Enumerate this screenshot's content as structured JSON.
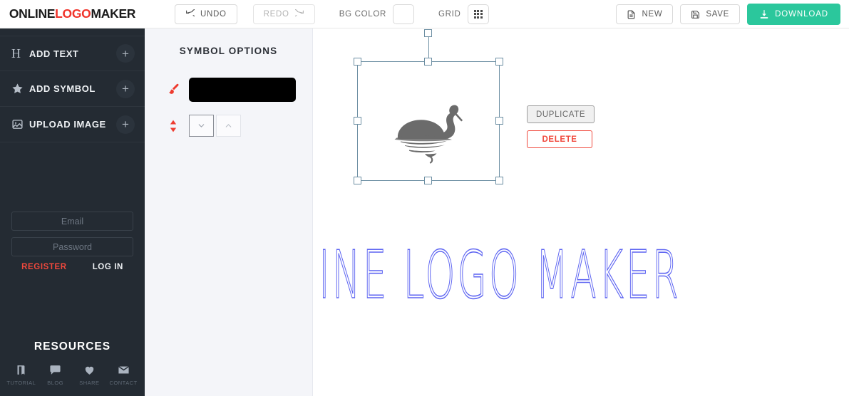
{
  "brand": {
    "part1": "ONLINE",
    "part2": "LOGO",
    "part3": "MAKER",
    "accent_color": "#f0342b"
  },
  "header": {
    "undo_label": "UNDO",
    "redo_label": "REDO",
    "bgcolor_label": "BG COLOR",
    "bgcolor_value": "#ffffff",
    "grid_label": "GRID",
    "new_label": "NEW",
    "save_label": "SAVE",
    "download_label": "DOWNLOAD",
    "download_color": "#2bc79c"
  },
  "sidebar": {
    "background": "#242b33",
    "items": [
      {
        "label": "ADD TEXT",
        "icon": "text-h-icon",
        "action": "+"
      },
      {
        "label": "ADD SYMBOL",
        "icon": "star-icon",
        "action": "+"
      },
      {
        "label": "UPLOAD IMAGE",
        "icon": "image-icon",
        "action": "+"
      }
    ],
    "auth": {
      "email_placeholder": "Email",
      "email_value": "",
      "password_placeholder": "Password",
      "password_value": "",
      "register_label": "REGISTER",
      "register_color": "#f0483c",
      "login_label": "LOG IN"
    },
    "resources": {
      "title": "RESOURCES",
      "items": [
        {
          "label": "TUTORIAL",
          "icon": "book-icon"
        },
        {
          "label": "BLOG",
          "icon": "speech-bubble-icon"
        },
        {
          "label": "SHARE",
          "icon": "heart-icon"
        },
        {
          "label": "CONTACT",
          "icon": "envelope-icon"
        }
      ]
    }
  },
  "panel": {
    "title": "SYMBOL OPTIONS",
    "background": "#f4f5f9",
    "color_option": {
      "icon": "paintbrush-icon",
      "swatch_value": "#000000"
    },
    "layer_option": {
      "icon": "updown-arrows-icon",
      "send_backward_label": "˅",
      "bring_forward_label": "˄"
    }
  },
  "canvas": {
    "selected_object": "swan-symbol",
    "selection_color": "#6d8fa3",
    "duplicate_label": "DUPLICATE",
    "delete_label": "DELETE",
    "delete_color": "#f0483c",
    "logo_text": "INE LOGO MAKER",
    "logo_text_color": "#5f66f2"
  }
}
